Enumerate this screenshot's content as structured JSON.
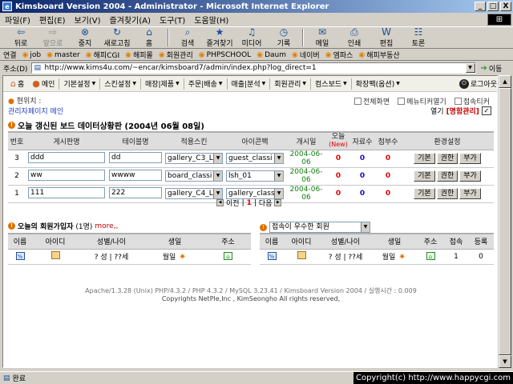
{
  "window": {
    "title": "Kimsboard Version 2004 - Administrator - Microsoft Internet Explorer",
    "min": "_",
    "max": "□",
    "close": "X"
  },
  "menu": [
    "파일(F)",
    "편집(E)",
    "보기(V)",
    "즐겨찾기(A)",
    "도구(T)",
    "도움말(H)"
  ],
  "toolbar": [
    {
      "label": "뒤로",
      "icon": "back-arrow-icon",
      "glyph": "⇦",
      "disabled": false
    },
    {
      "label": "앞으로",
      "icon": "forward-arrow-icon",
      "glyph": "⇨",
      "disabled": true
    },
    {
      "label": "중지",
      "icon": "stop-icon",
      "glyph": "⊗",
      "disabled": false
    },
    {
      "label": "새로고침",
      "icon": "refresh-icon",
      "glyph": "↻",
      "disabled": false
    },
    {
      "label": "홈",
      "icon": "home-icon",
      "glyph": "⌂",
      "disabled": false
    },
    {
      "label": "검색",
      "icon": "search-icon",
      "glyph": "⌕",
      "disabled": false
    },
    {
      "label": "즐겨찾기",
      "icon": "favorites-icon",
      "glyph": "★",
      "disabled": false
    },
    {
      "label": "미디어",
      "icon": "media-icon",
      "glyph": "♫",
      "disabled": false
    },
    {
      "label": "기록",
      "icon": "history-icon",
      "glyph": "◷",
      "disabled": false
    },
    {
      "label": "메일",
      "icon": "mail-icon",
      "glyph": "✉",
      "disabled": false
    },
    {
      "label": "인쇄",
      "icon": "print-icon",
      "glyph": "⎙",
      "disabled": false
    },
    {
      "label": "편집",
      "icon": "edit-icon",
      "glyph": "W",
      "disabled": false
    },
    {
      "label": "토론",
      "icon": "discuss-icon",
      "glyph": "☷",
      "disabled": false
    }
  ],
  "links": {
    "label": "연결",
    "items": [
      "job",
      "master",
      "해피CGI",
      "해피몰",
      "회원관리",
      "PHPSCHOOL",
      "Daum",
      "네이버",
      "엠파스",
      "해피부동산"
    ]
  },
  "address": {
    "label": "주소(D)",
    "url": "http://www.kims4u.com/~encar/kimsboard7/admin/index.php?log_direct=1",
    "go": "이동"
  },
  "topnav": {
    "home": "홈",
    "main": "메인",
    "items": [
      "기본설정",
      "스킨설정",
      "매장|제품",
      "주문|배송",
      "매출|분석",
      "회원관리",
      "컴스보드",
      "확장팩(옵션)"
    ],
    "logout": "로그아웃"
  },
  "location": {
    "label": "현위치 :",
    "value": "관리자페이지 메인"
  },
  "checks": [
    "전체화면",
    "메뉴티커열기",
    "접속티커"
  ],
  "open": {
    "label": "열기",
    "highlight": "[명함관리]",
    "ok": "✓"
  },
  "board_section": {
    "title": "오늘 갱신된 보드 데이터상황판 (2004년 06월 08일)",
    "headers": [
      "번호",
      "게시판명",
      "테이블명",
      "적용스킨",
      "아이콘팩",
      "개시일",
      "오늘",
      "(New)",
      "자료수",
      "첨부수",
      "환경설정"
    ],
    "rows": [
      {
        "no": "3",
        "name": "ddd",
        "table": "dd",
        "skin": "gallery_C3_L",
        "icon": "guest_classi",
        "date": "2004-06-06",
        "today": "0",
        "count": "0",
        "attach": "0"
      },
      {
        "no": "2",
        "name": "ww",
        "table": "wwww",
        "skin": "board_classi",
        "icon": "lsh_01",
        "date": "2004-06-06",
        "today": "0",
        "count": "0",
        "attach": "0"
      },
      {
        "no": "1",
        "name": "111",
        "table": "222",
        "skin": "gallery_C4_L",
        "icon": "gallery_class",
        "date": "2004-06-06",
        "today": "0",
        "count": "0",
        "attach": "0"
      }
    ],
    "buttons": [
      "기본",
      "권한",
      "부가"
    ]
  },
  "pager": {
    "prev": "이전",
    "sep1": "|",
    "current": "1",
    "sep2": "|",
    "next": "다음"
  },
  "new_members": {
    "title": "오늘의 회원가입자",
    "count": "(1명)",
    "more": "more,,",
    "headers": [
      "이름",
      "아이디",
      "성별/나이",
      "생일",
      "주소"
    ],
    "row": {
      "gender_age": "? 성 | ??세",
      "birthday": "월일"
    }
  },
  "rank_members": {
    "select": "접속이 우수한 회원",
    "headers": [
      "이름",
      "아이디",
      "성별/나이",
      "생일",
      "주소",
      "접속",
      "등록"
    ],
    "row": {
      "gender_age": "? 성 | ??세",
      "birthday": "월일",
      "visits": "1",
      "reg": "0"
    }
  },
  "footer": {
    "line1": "Apache/1.3.28 (Unix) PHP/4.3.2 / PHP 4.3.2 / MySQL 3.23.41 / Kimsboard Version 2004 / 실행시간 : 0.009",
    "line2": "Copyrights NetPle,Inc , KimSeongho All rights reserved,"
  },
  "status": {
    "text": "완료",
    "copyright": "Copyright(c) http://www.happycgi.com"
  }
}
